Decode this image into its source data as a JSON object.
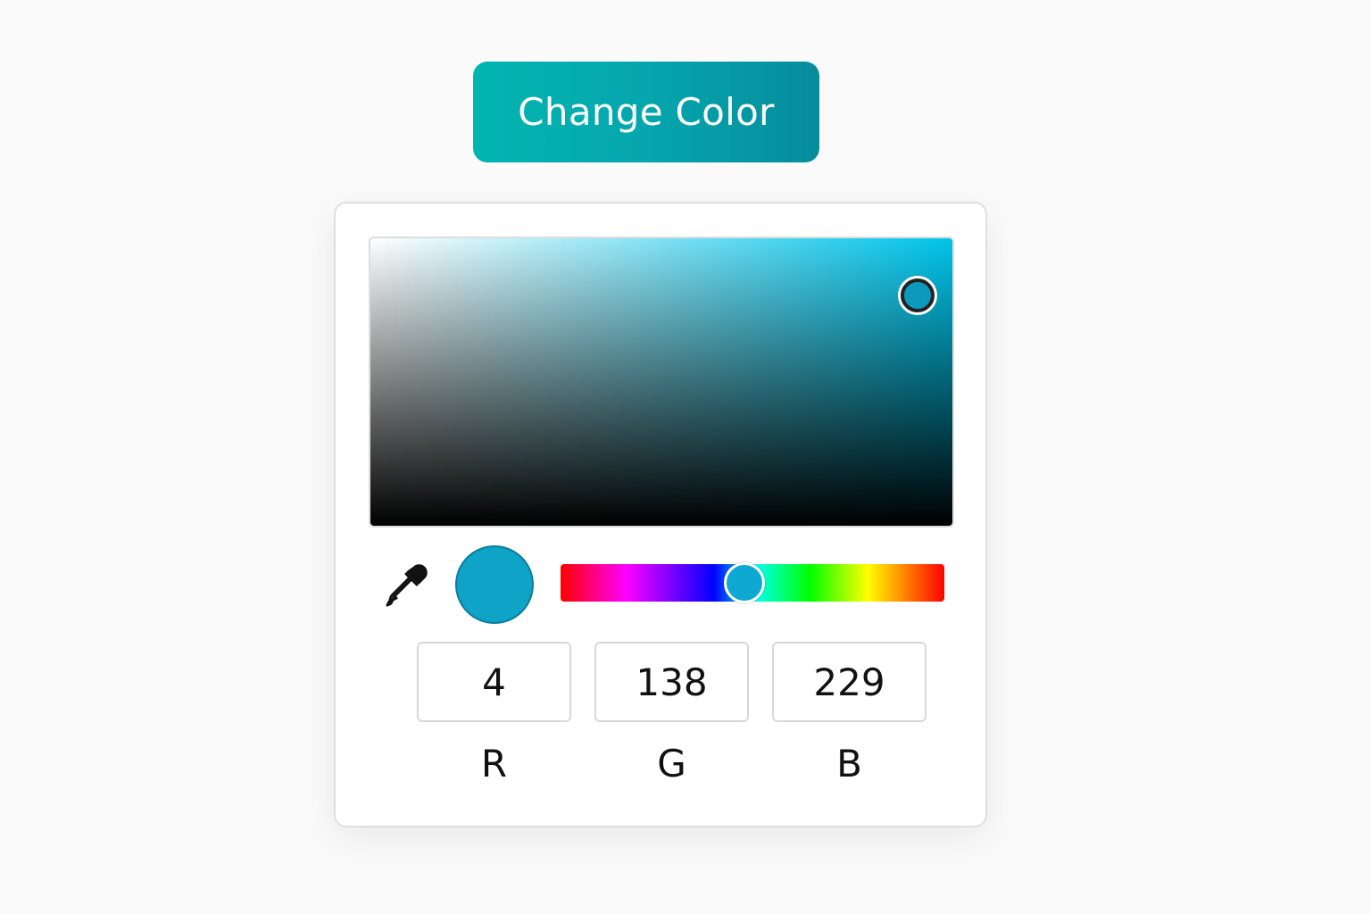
{
  "change_button": {
    "label": "Change Color"
  },
  "picker": {
    "current_color": "#0fa3c8",
    "hue_color": "#00c4ea",
    "saturation_value": {
      "saturation": 0.94,
      "value": 0.8
    },
    "hue_position": 0.48,
    "channels": [
      {
        "label": "R",
        "value": "4"
      },
      {
        "label": "G",
        "value": "138"
      },
      {
        "label": "B",
        "value": "229"
      }
    ]
  },
  "icons": {
    "eyedropper": "eyedropper-icon"
  }
}
